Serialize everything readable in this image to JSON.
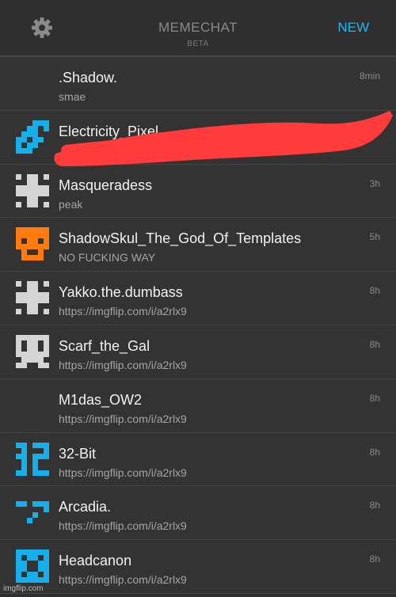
{
  "header": {
    "settings_icon": "gear-icon",
    "title": "MEMECHAT",
    "subtitle": "BETA",
    "new_label": "NEW",
    "accent_color": "#1bb8ef"
  },
  "chats": [
    {
      "name": ".Shadow.",
      "message": "smae",
      "time": "8min",
      "avatar": "none"
    },
    {
      "name": "Electricity_Pixel",
      "message": "",
      "time": "",
      "avatar": "blue-pixel-icon"
    },
    {
      "name": "Masqueradess",
      "message": "peak",
      "time": "3h",
      "avatar": "grey-cross-pixel-icon"
    },
    {
      "name": "ShadowSkul_The_God_Of_Templates",
      "message": "NO FUCKING WAY",
      "time": "5h",
      "avatar": "orange-skull-pixel-icon"
    },
    {
      "name": "Yakko.the.dumbass",
      "message": "https://imgflip.com/i/a2rlx9",
      "time": "8h",
      "avatar": "grey-cross-pixel-icon"
    },
    {
      "name": "Scarf_the_Gal",
      "message": "https://imgflip.com/i/a2rlx9",
      "time": "8h",
      "avatar": "grey-face-pixel-icon"
    },
    {
      "name": "M1das_OW2",
      "message": "https://imgflip.com/i/a2rlx9",
      "time": "8h",
      "avatar": "none"
    },
    {
      "name": "32-Bit",
      "message": "https://imgflip.com/i/a2rlx9",
      "time": "8h",
      "avatar": "blue-32-pixel-icon"
    },
    {
      "name": "Arcadia.",
      "message": "https://imgflip.com/i/a2rlx9",
      "time": "8h",
      "avatar": "blue-dots-pixel-icon"
    },
    {
      "name": "Headcanon",
      "message": "https://imgflip.com/i/a2rlx9",
      "time": "8h",
      "avatar": "blue-checker-pixel-icon"
    }
  ],
  "watermark": "imgflip.com",
  "redaction_color": "#ff3b3b"
}
